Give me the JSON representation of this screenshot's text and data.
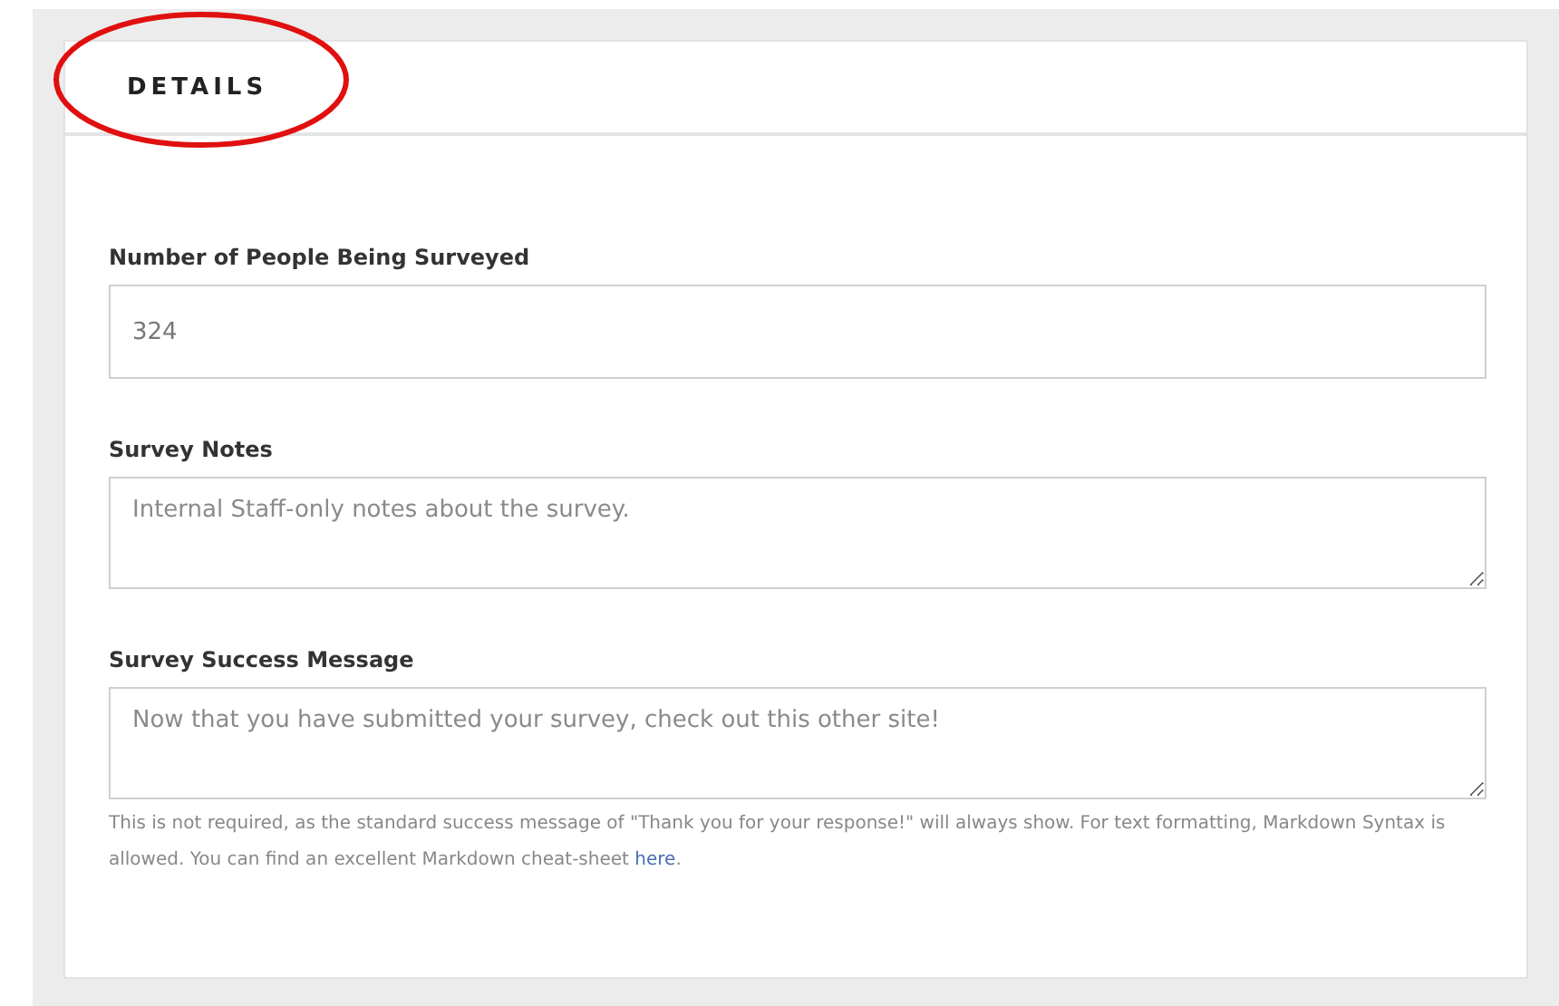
{
  "section": {
    "title": "DETAILS"
  },
  "fields": [
    {
      "kind": "input",
      "label": "Number of People Being Surveyed",
      "value": "324"
    },
    {
      "kind": "textarea",
      "label": "Survey Notes",
      "placeholder": "Internal Staff-only notes about the survey."
    },
    {
      "kind": "textarea",
      "label": "Survey Success Message",
      "placeholder": "Now that you have submitted your survey, check out this other site!",
      "help": "This is not required, as the standard success message of \"Thank you for your response!\" will always show. For text formatting, Markdown Syntax is allowed. You can find an excellent Markdown cheat-sheet ",
      "help_link": "here",
      "help_end": "."
    }
  ]
}
